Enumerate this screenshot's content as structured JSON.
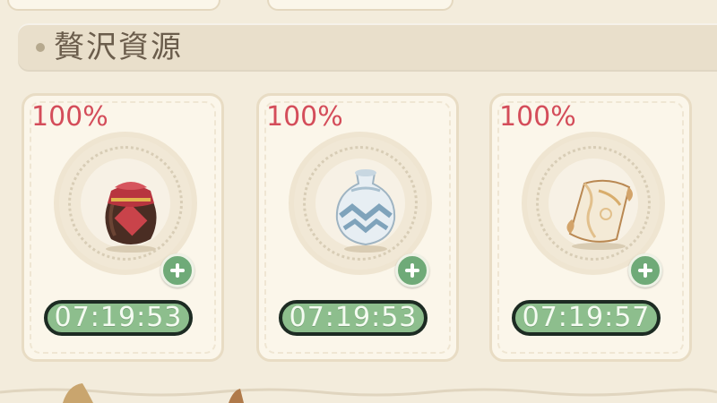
{
  "header": {
    "title": "贅沢資源"
  },
  "cards": [
    {
      "percent": "100%",
      "timer": "07:19:53",
      "icon": "wine-jar-icon"
    },
    {
      "percent": "100%",
      "timer": "07:19:53",
      "icon": "porcelain-vase-icon"
    },
    {
      "percent": "100%",
      "timer": "07:19:57",
      "icon": "silk-scroll-icon"
    }
  ],
  "colors": {
    "background": "#f3ecdc",
    "card": "#fbf6ea",
    "percent_red": "#d44d5a",
    "timer_green": "#8dbe8d",
    "plus_green": "#6faa78"
  }
}
